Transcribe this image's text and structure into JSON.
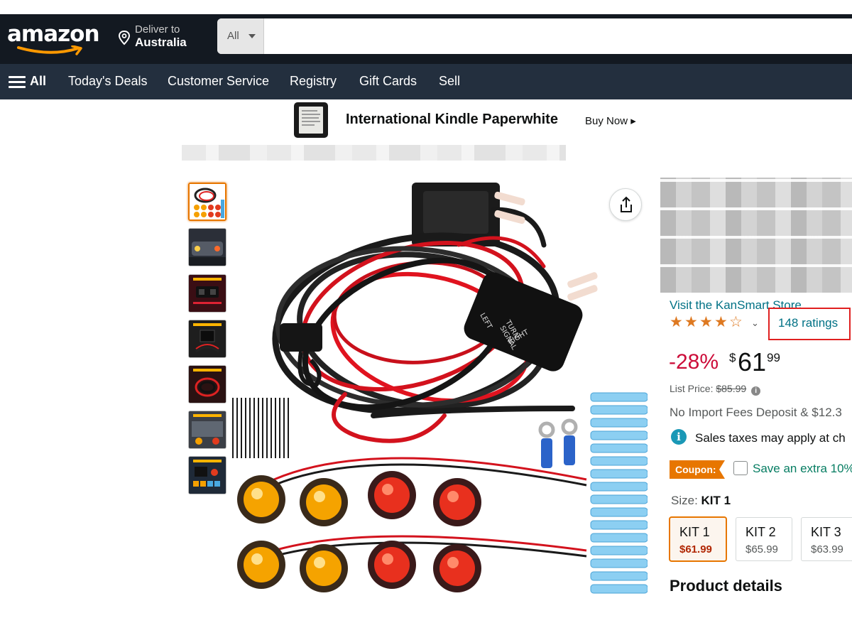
{
  "header": {
    "logo_text": "amazon",
    "deliver_line1": "Deliver to",
    "deliver_line2": "Australia",
    "search_category": "All",
    "search_value": ""
  },
  "nav": {
    "all_label": "All",
    "items": [
      "Today's Deals",
      "Customer Service",
      "Registry",
      "Gift Cards",
      "Sell"
    ]
  },
  "promo": {
    "title": "International Kindle Paperwhite",
    "cta": "Buy Now ▸"
  },
  "product": {
    "store_link": "Visit the KanSmart Store",
    "rating_stars": 4.5,
    "ratings_count": "148 ratings",
    "discount": "-28%",
    "currency_symbol": "$",
    "price_whole": "61",
    "price_fraction": "99",
    "list_price_label": "List Price:",
    "list_price_value": "$85.99",
    "import_fees": "No Import Fees Deposit & $12.3",
    "sales_tax": "Sales taxes may apply at ch",
    "coupon_label": "Coupon:",
    "coupon_text": "Save an extra 10%",
    "size_label": "Size:",
    "size_value": "KIT 1",
    "sizes": [
      {
        "name": "KIT 1",
        "price": "$61.99",
        "selected": true
      },
      {
        "name": "KIT 2",
        "price": "$65.99",
        "selected": false
      },
      {
        "name": "KIT 3",
        "price": "$63.99",
        "selected": false
      }
    ],
    "section_heading": "Product details"
  },
  "colors": {
    "header_bg": "#131921",
    "nav_bg": "#232f3e",
    "link": "#007185",
    "discount": "#cc0c39",
    "star": "#de7921",
    "coupon_bg": "#e77600",
    "coupon_text": "#067d62",
    "highlight_box": "#e02020"
  },
  "icons": {
    "location": "map-pin-icon",
    "share": "share-icon",
    "info": "info-icon",
    "menu": "hamburger-icon"
  }
}
